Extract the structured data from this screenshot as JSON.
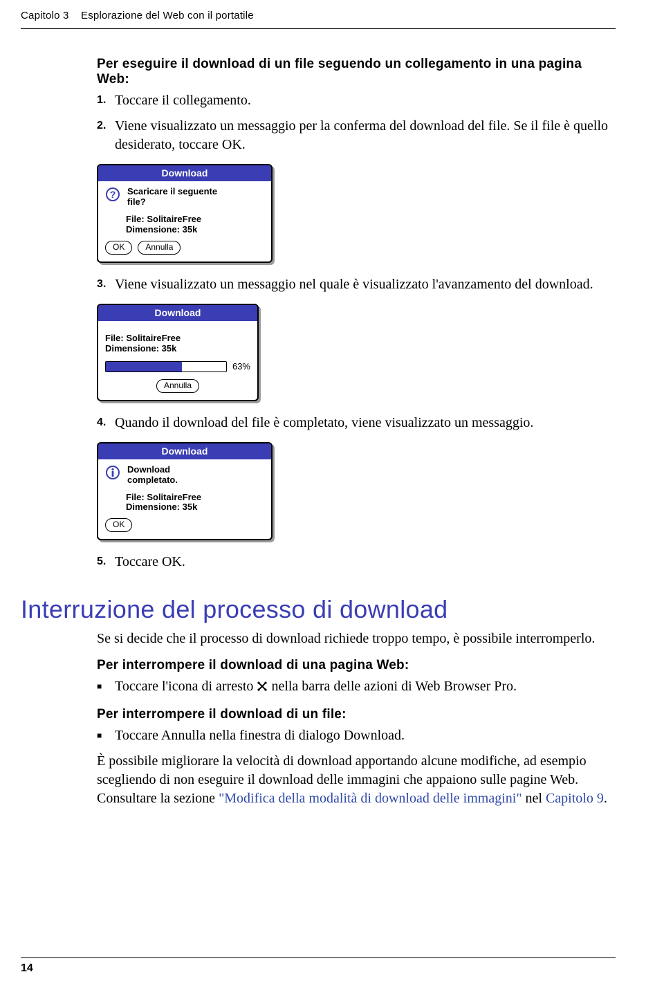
{
  "header": {
    "chapter_label": "Capitolo 3",
    "chapter_title": "Esplorazione del Web con il portatile"
  },
  "section1": {
    "subhead": "Per eseguire il download di un file seguendo un collegamento in una pagina Web:",
    "steps": {
      "s1": {
        "num": "1.",
        "text": "Toccare il collegamento."
      },
      "s2": {
        "num": "2.",
        "text": "Viene visualizzato un messaggio per la conferma del download del file. Se il file è quello desiderato, toccare OK."
      },
      "s3": {
        "num": "3.",
        "text": "Viene visualizzato un messaggio nel quale è visualizzato l'avanzamento del download."
      },
      "s4": {
        "num": "4.",
        "text": "Quando il download del file è completato, viene visualizzato un messaggio."
      },
      "s5": {
        "num": "5.",
        "text": "Toccare OK."
      }
    }
  },
  "dialogs": {
    "confirm": {
      "title": "Download",
      "question_line1": "Scaricare il seguente",
      "question_line2": "file?",
      "file_label": "File: SolitaireFree",
      "size_label": "Dimensione: 35k",
      "ok": "OK",
      "cancel": "Annulla"
    },
    "progress": {
      "title": "Download",
      "file_label": "File: SolitaireFree",
      "size_label": "Dimensione: 35k",
      "percent": "63%",
      "cancel": "Annulla"
    },
    "done": {
      "title": "Download",
      "msg_line1": "Download",
      "msg_line2": "completato.",
      "file_label": "File: SolitaireFree",
      "size_label": "Dimensione: 35k",
      "ok": "OK"
    }
  },
  "section2": {
    "heading": "Interruzione del processo di download",
    "intro": "Se si decide che il processo di download richiede troppo tempo, è possibile interromperlo.",
    "sub1": "Per interrompere il download di una pagina Web:",
    "bullet1_a": "Toccare l'icona di arresto ",
    "bullet1_b": " nella barra delle azioni di Web Browser Pro.",
    "sub2": "Per interrompere il download di un file:",
    "bullet2": "Toccare Annulla nella finestra di dialogo Download.",
    "para_a": "È possibile migliorare la velocità di download apportando alcune modifiche, ad esempio scegliendo di non eseguire il download delle immagini che appaiono sulle pagine Web. Consultare la sezione ",
    "link1": "\"Modifica della modalità di download delle immagini\"",
    "para_b": " nel ",
    "link2": "Capitolo 9",
    "para_c": "."
  },
  "footer": {
    "page_number": "14"
  }
}
